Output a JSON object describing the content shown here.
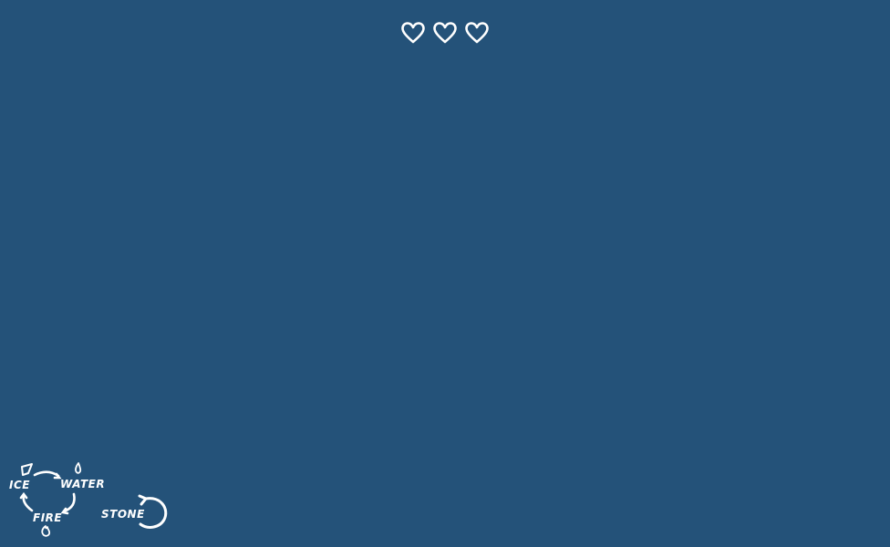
{
  "hud": {
    "lives": {
      "current": 3,
      "max": 3
    },
    "heart_icon": "heart-outline-icon",
    "accent_color": "#ffffff",
    "background_color": "#245279"
  },
  "element_cycle": {
    "labels": {
      "ice": "ICE",
      "water": "WATER",
      "fire": "FIRE",
      "stone": "STONE"
    },
    "icons": {
      "ice": "ice-crystal-icon",
      "water": "water-drop-icon",
      "fire": "flame-icon",
      "stone": "stone-cycle-arrow-icon"
    }
  }
}
